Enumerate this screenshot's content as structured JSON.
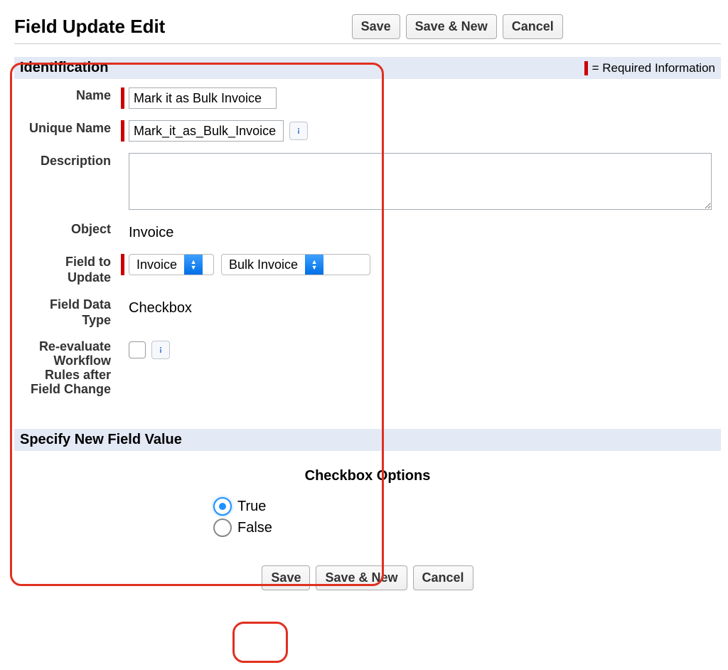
{
  "page": {
    "title": "Field Update Edit",
    "required_legend": "= Required Information"
  },
  "buttons": {
    "save": "Save",
    "save_new": "Save & New",
    "cancel": "Cancel"
  },
  "sections": {
    "identification": "Identification",
    "specify": "Specify New Field Value"
  },
  "labels": {
    "name": "Name",
    "unique_name": "Unique Name",
    "description": "Description",
    "object": "Object",
    "field_to_update": "Field to Update",
    "field_data_type": "Field Data Type",
    "reevaluate": "Re-evaluate Workflow Rules after Field Change",
    "checkbox_options": "Checkbox Options",
    "true": "True",
    "false": "False"
  },
  "values": {
    "name": "Mark it as Bulk Invoice",
    "unique_name": "Mark_it_as_Bulk_Invoice",
    "description": "",
    "object": "Invoice",
    "field_select_1": "Invoice",
    "field_select_2": "Bulk Invoice",
    "field_data_type": "Checkbox",
    "reevaluate_checked": false,
    "radio_selected": "true"
  }
}
